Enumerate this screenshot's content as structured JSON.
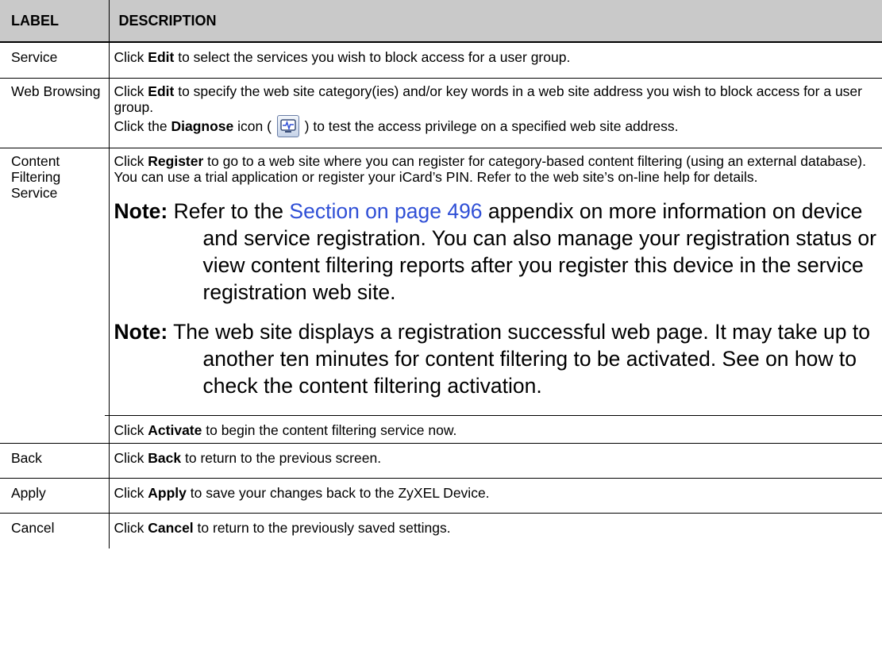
{
  "header": {
    "label": "LABEL",
    "description": "DESCRIPTION"
  },
  "rows": {
    "service": {
      "label": "Service",
      "pre": "Click ",
      "bold": "Edit",
      "post": " to select the services you wish to block access for a user group."
    },
    "web": {
      "label": "Web Browsing",
      "p1_pre": "Click ",
      "p1_bold": "Edit",
      "p1_post": " to specify the web site category(ies) and/or  key words in a web site address you wish to block access for a user group.",
      "p2_pre": "Click the ",
      "p2_bold": "Diagnose",
      "p2_mid": " icon ( ",
      "p2_post": " ) to test the access privilege on a specified web site address."
    },
    "content": {
      "label_line1": "Content",
      "label_line2": "Filtering",
      "label_line3": "Service",
      "p1_pre": "Click ",
      "p1_bold": "Register",
      "p1_post": " to go to a web site where you can register for category-based content filtering (using an external database). You can use a trial application or register your iCard’s PIN. Refer to the web site’s on-line help for details.",
      "note1_label": "Note:",
      "note1_pre": " Refer to the ",
      "note1_link": "Section  on page 496",
      "note1_post": " appendix on more information on device and service registration. You can also manage your registration status or view content filtering reports after you register this device in the service registration web site.",
      "note2_label": "Note:",
      "note2_text": " The web site displays a registration successful web page. It may take up to another ten minutes for content filtering to be activated. See  on how to check the content filtering activation.",
      "act_pre": "Click ",
      "act_bold": "Activate",
      "act_post": " to begin the content filtering service now."
    },
    "back": {
      "label": "Back",
      "pre": "Click ",
      "bold": "Back",
      "post": " to return to the previous screen."
    },
    "apply": {
      "label": "Apply",
      "pre": "Click ",
      "bold": "Apply",
      "post": " to save your changes back to the ZyXEL Device."
    },
    "cancel": {
      "label": "Cancel",
      "pre": "Click ",
      "bold": "Cancel",
      "post": " to return to the previously saved settings."
    }
  },
  "icons": {
    "diagnose": "diagnose-icon"
  }
}
